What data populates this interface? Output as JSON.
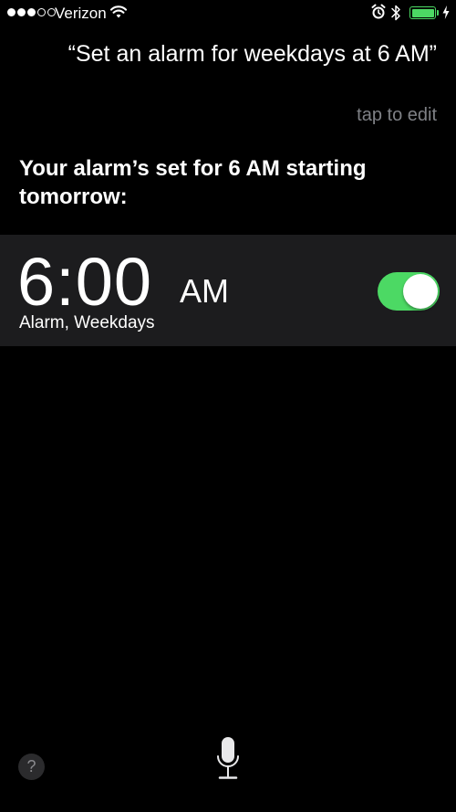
{
  "status_bar": {
    "signal_filled": 3,
    "signal_total": 5,
    "carrier": "Verizon",
    "wifi_icon": "wifi-icon",
    "alarm_icon": "alarm-clock-icon",
    "bluetooth_icon": "bluetooth-icon",
    "battery_level": 1.0,
    "charging": true,
    "battery_color": "#4cd964"
  },
  "siri": {
    "query": "“Set an alarm for weekdays at 6 AM”",
    "tap_to_edit": "tap to edit",
    "response": "Your alarm’s set for 6 AM starting tomorrow:"
  },
  "alarm": {
    "time": "6:00",
    "ampm": "AM",
    "label": "Alarm, Weekdays",
    "enabled": true,
    "toggle_color": "#4cd964"
  },
  "controls": {
    "help_label": "?",
    "mic_icon": "microphone-icon"
  }
}
